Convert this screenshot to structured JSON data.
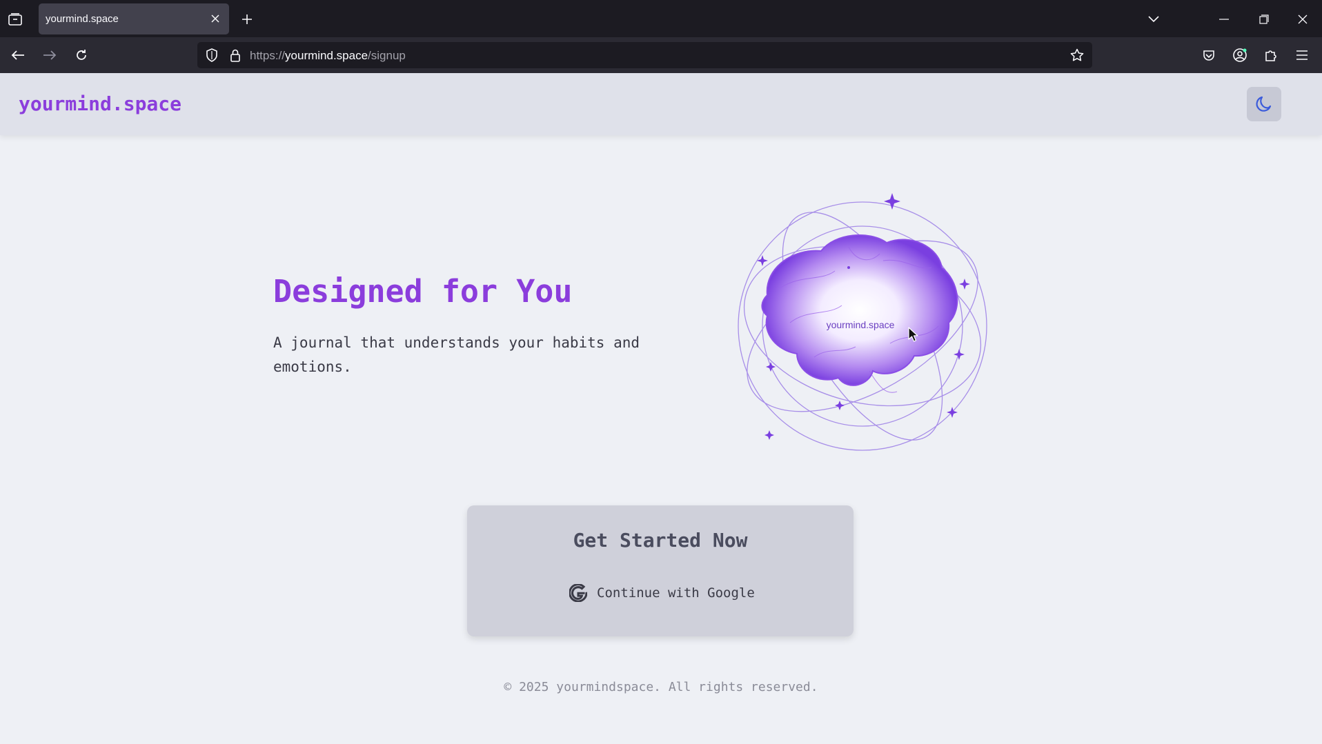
{
  "browser": {
    "tab_title": "yourmind.space",
    "url_scheme": "https://",
    "url_host": "yourmind.space",
    "url_path": "/signup"
  },
  "header": {
    "logo": "yourmind.space",
    "theme_toggle_icon": "moon-icon"
  },
  "hero": {
    "title": "Designed for You",
    "subtitle": "A journal that understands your habits and emotions."
  },
  "illustration": {
    "label": "yourmind.space",
    "icon": "brain-orbit-illustration"
  },
  "signup_card": {
    "title": "Get Started Now",
    "google_button_label": "Continue with Google",
    "google_icon": "google-icon"
  },
  "footer": {
    "copyright": "© 2025 yourmindspace. All rights reserved."
  },
  "colors": {
    "accent": "#8b3ddc",
    "page_bg": "#eef0f5",
    "header_bg": "#dfe1ea",
    "card_bg": "#cfd0da",
    "moon": "#3b5bdb"
  }
}
